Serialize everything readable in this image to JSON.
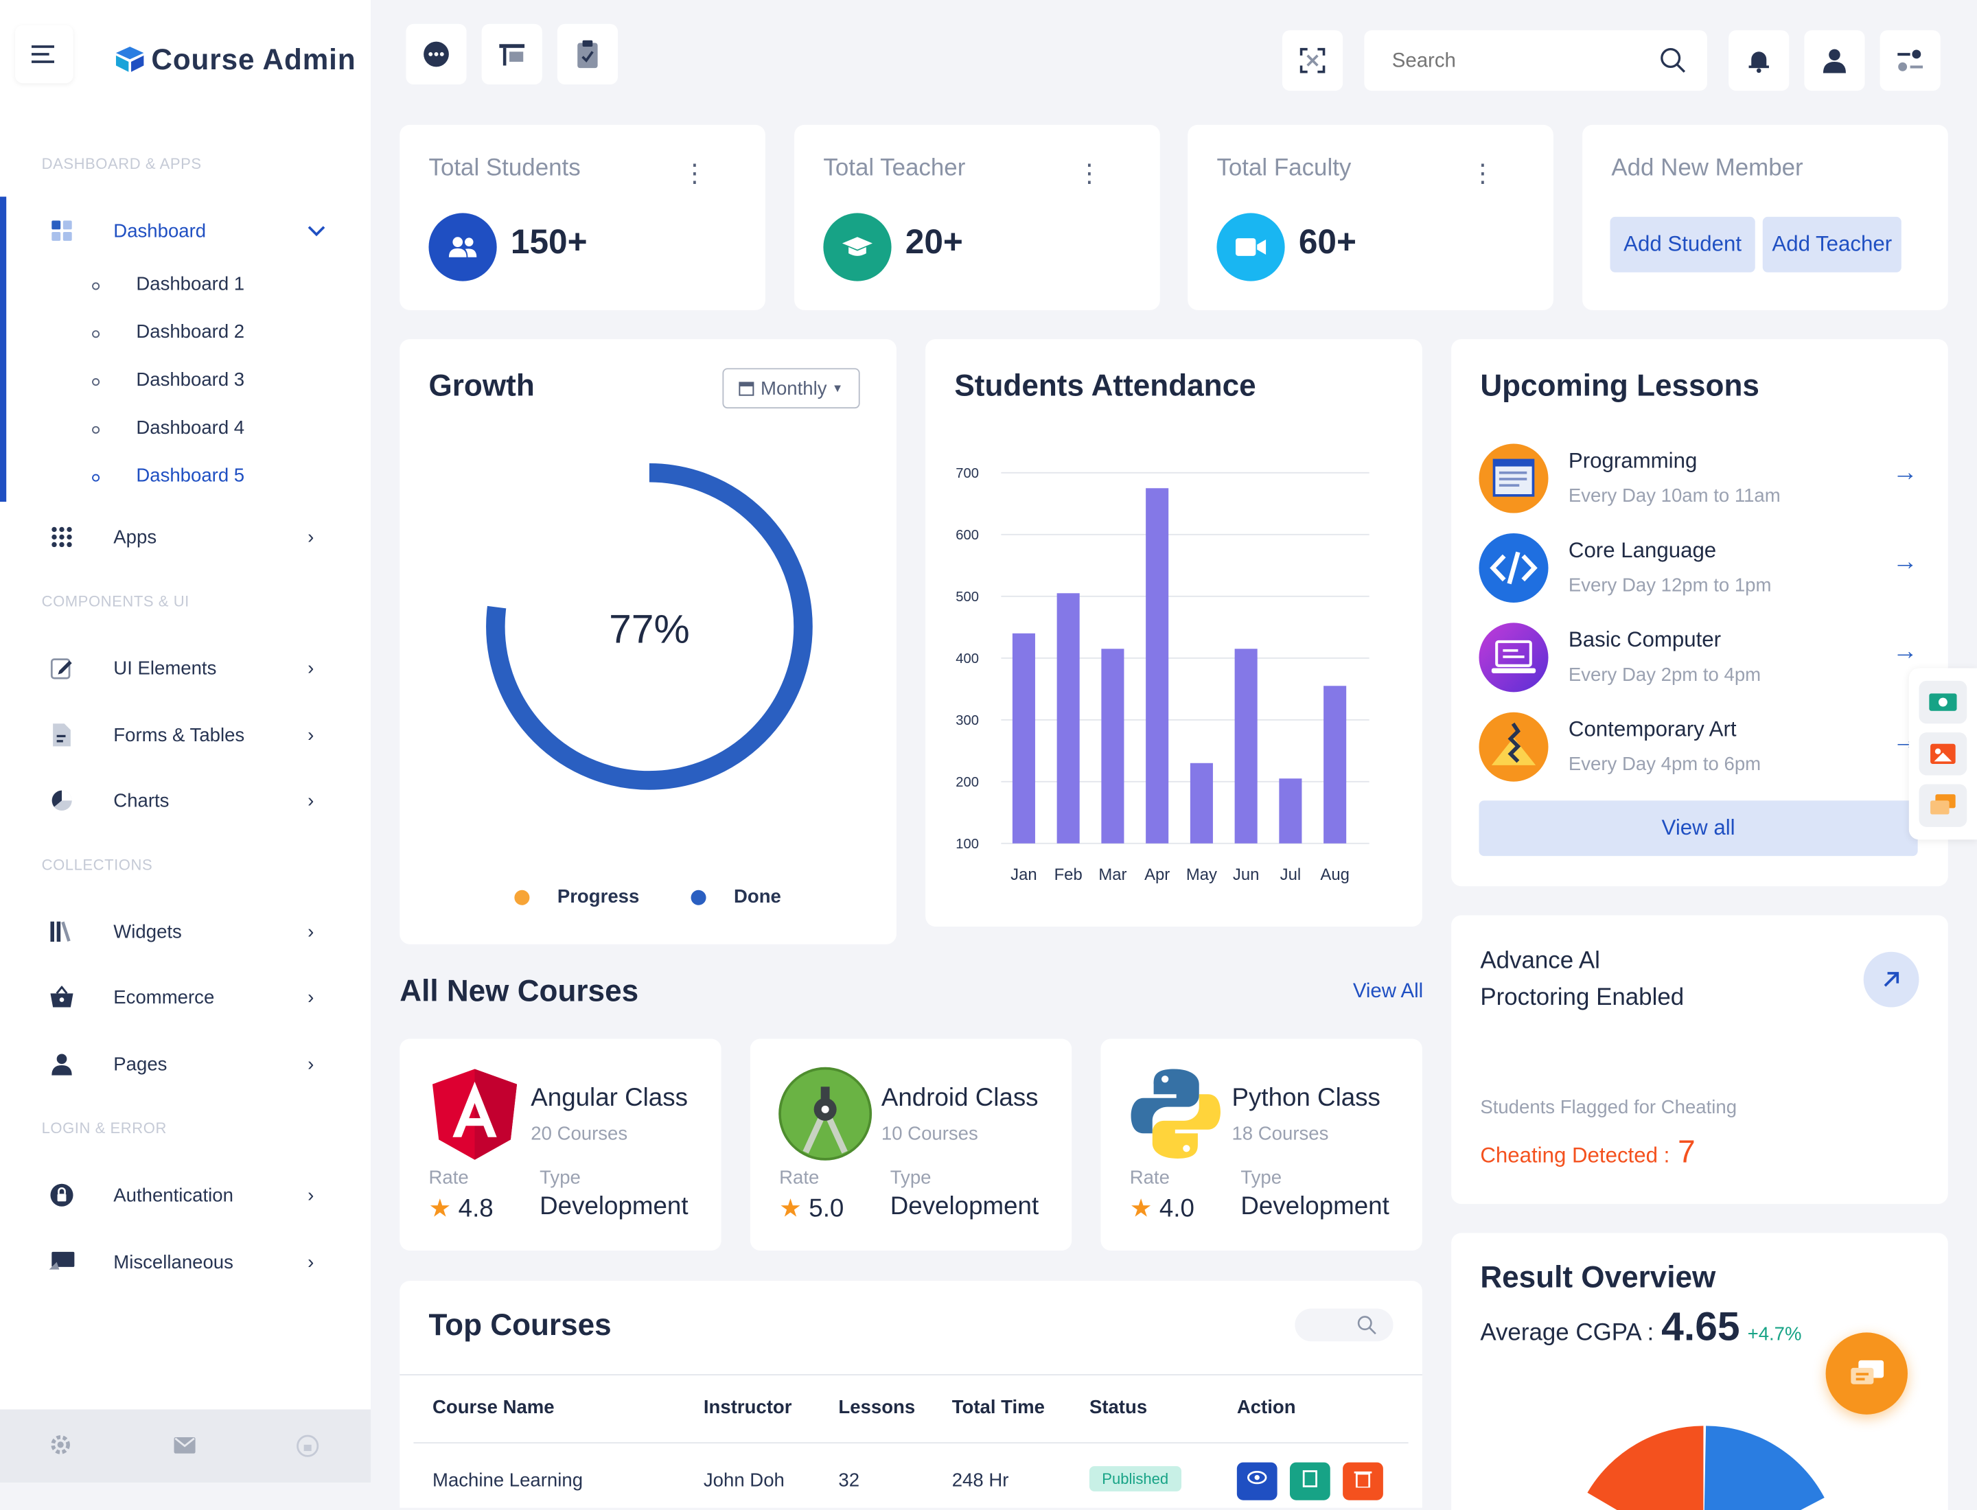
{
  "sidebar": {
    "brand": "Course Admin",
    "sections": {
      "dashboard_apps": "DASHBOARD & APPS",
      "components_ui": "COMPONENTS & UI",
      "collections": "COLLECTIONS",
      "login_error": "LOGIN & ERROR"
    },
    "dashboard": {
      "label": "Dashboard",
      "subitems": [
        "Dashboard 1",
        "Dashboard 2",
        "Dashboard 3",
        "Dashboard 4",
        "Dashboard 5"
      ]
    },
    "items": {
      "apps": "Apps",
      "ui_elements": "UI Elements",
      "forms_tables": "Forms & Tables",
      "charts": "Charts",
      "widgets": "Widgets",
      "ecommerce": "Ecommerce",
      "pages": "Pages",
      "authentication": "Authentication",
      "miscellaneous": "Miscellaneous"
    }
  },
  "topbar": {
    "search_placeholder": "Search"
  },
  "stats": [
    {
      "title": "Total Students",
      "value": "150+",
      "icon": "users-icon",
      "color": "#1f4fc2"
    },
    {
      "title": "Total Teacher",
      "value": "20+",
      "icon": "graduation-cap-icon",
      "color": "#17a386"
    },
    {
      "title": "Total Faculty",
      "value": "60+",
      "icon": "video-icon",
      "color": "#19b6f2"
    }
  ],
  "add_member": {
    "title": "Add New Member",
    "add_student": "Add Student",
    "add_teacher": "Add Teacher"
  },
  "growth": {
    "title": "Growth",
    "period": "Monthly",
    "percent": "77%",
    "progress_value": 0.23,
    "done_value": 0.77,
    "legend_progress": "Progress",
    "legend_done": "Done",
    "progress_color": "#f7a436",
    "done_color": "#2a5fc1"
  },
  "chart_data": {
    "type": "bar",
    "title": "Students Attendance",
    "categories": [
      "Jan",
      "Feb",
      "Mar",
      "Apr",
      "May",
      "Jun",
      "Jul",
      "Aug"
    ],
    "values": [
      440,
      505,
      415,
      675,
      230,
      415,
      205,
      355
    ],
    "ylim": [
      100,
      700
    ],
    "yticks": [
      100,
      200,
      300,
      400,
      500,
      600,
      700
    ],
    "xlabel": "",
    "ylabel": "",
    "grid": true,
    "bar_color": "#8478e7"
  },
  "lessons": {
    "title": "Upcoming Lessons",
    "items": [
      {
        "name": "Programming",
        "time": "Every Day 10am to 11am"
      },
      {
        "name": "Core Language",
        "time": "Every Day 12pm to 1pm"
      },
      {
        "name": "Basic Computer",
        "time": "Every Day 2pm to 4pm"
      },
      {
        "name": "Contemporary Art",
        "time": "Every Day 4pm to 6pm"
      }
    ],
    "view_all": "View all"
  },
  "courses": {
    "title": "All New Courses",
    "view_all": "View All",
    "items": [
      {
        "name": "Angular Class",
        "count": "20 Courses",
        "rate_label": "Rate",
        "rate": "4.8",
        "type_label": "Type",
        "type": "Development"
      },
      {
        "name": "Android Class",
        "count": "10 Courses",
        "rate_label": "Rate",
        "rate": "5.0",
        "type_label": "Type",
        "type": "Development"
      },
      {
        "name": "Python Class",
        "count": "18 Courses",
        "rate_label": "Rate",
        "rate": "4.0",
        "type_label": "Type",
        "type": "Development"
      }
    ]
  },
  "proctoring": {
    "title_line1": "Advance Al",
    "title_line2": "Proctoring Enabled",
    "flag_label": "Students Flagged for Cheating",
    "detected_label": "Cheating Detected :",
    "detected_value": "7"
  },
  "top_courses": {
    "title": "Top Courses",
    "headers": [
      "Course Name",
      "Instructor",
      "Lessons",
      "Total Time",
      "Status",
      "Action"
    ],
    "row": {
      "course": "Machine Learning",
      "instructor": "John Doh",
      "lessons": "32",
      "time": "248 Hr",
      "status": "Published"
    }
  },
  "result": {
    "title": "Result Overview",
    "cgpa_label": "Average CGPA :",
    "cgpa_value": "4.65",
    "change": "+4.7%"
  }
}
